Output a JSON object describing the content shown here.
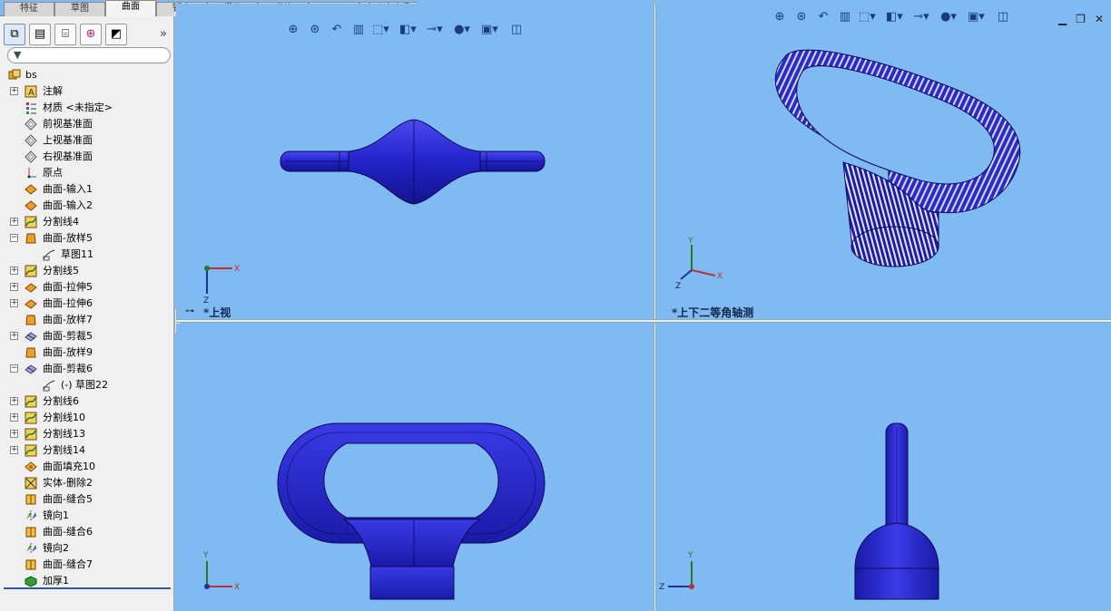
{
  "tabs": [
    "特征",
    "草图",
    "曲面",
    "钣金",
    "焊件",
    "评估",
    "DimXpert",
    "办公室产品"
  ],
  "active_tab": "曲面",
  "panel": {
    "toolbar_icons": [
      "feature-manager-icon",
      "property-manager-icon",
      "configuration-manager-icon",
      "dimxpert-manager-icon",
      "display-manager-icon"
    ],
    "more": "»",
    "filter_icon": "filter-icon",
    "root": "bs",
    "items": [
      {
        "label": "注解",
        "icon": "annotation-icon",
        "expand": "+",
        "level": 1
      },
      {
        "label": "材质 <未指定>",
        "icon": "material-icon",
        "expand": "",
        "level": 1
      },
      {
        "label": "前视基准面",
        "icon": "plane-icon",
        "expand": "",
        "level": 1
      },
      {
        "label": "上视基准面",
        "icon": "plane-icon",
        "expand": "",
        "level": 1
      },
      {
        "label": "右视基准面",
        "icon": "plane-icon",
        "expand": "",
        "level": 1
      },
      {
        "label": "原点",
        "icon": "origin-icon",
        "expand": "",
        "level": 1
      },
      {
        "label": "曲面-输入1",
        "icon": "surface-import-icon",
        "expand": "",
        "level": 1
      },
      {
        "label": "曲面-输入2",
        "icon": "surface-import-icon",
        "expand": "",
        "level": 1
      },
      {
        "label": "分割线4",
        "icon": "split-line-icon",
        "expand": "+",
        "level": 1
      },
      {
        "label": "曲面-放样5",
        "icon": "surface-loft-icon",
        "expand": "−",
        "level": 1
      },
      {
        "label": "草图11",
        "icon": "sketch-icon",
        "expand": "",
        "level": 2
      },
      {
        "label": "分割线5",
        "icon": "split-line-icon",
        "expand": "+",
        "level": 1
      },
      {
        "label": "曲面-拉伸5",
        "icon": "surface-extrude-icon",
        "expand": "+",
        "level": 1
      },
      {
        "label": "曲面-拉伸6",
        "icon": "surface-extrude-icon",
        "expand": "+",
        "level": 1
      },
      {
        "label": "曲面-放样7",
        "icon": "surface-loft-icon",
        "expand": "",
        "level": 1
      },
      {
        "label": "曲面-剪裁5",
        "icon": "surface-trim-icon",
        "expand": "+",
        "level": 1
      },
      {
        "label": "曲面-放样9",
        "icon": "surface-loft-icon",
        "expand": "",
        "level": 1
      },
      {
        "label": "曲面-剪裁6",
        "icon": "surface-trim-icon",
        "expand": "−",
        "level": 1
      },
      {
        "label": "(-) 草图22",
        "icon": "sketch-icon",
        "expand": "",
        "level": 2
      },
      {
        "label": "分割线6",
        "icon": "split-line-icon",
        "expand": "+",
        "level": 1
      },
      {
        "label": "分割线10",
        "icon": "split-line-icon",
        "expand": "+",
        "level": 1
      },
      {
        "label": "分割线13",
        "icon": "split-line-icon",
        "expand": "+",
        "level": 1
      },
      {
        "label": "分割线14",
        "icon": "split-line-icon",
        "expand": "+",
        "level": 1
      },
      {
        "label": "曲面填充10",
        "icon": "surface-fill-icon",
        "expand": "",
        "level": 1
      },
      {
        "label": "实体-删除2",
        "icon": "body-delete-icon",
        "expand": "",
        "level": 1
      },
      {
        "label": "曲面-缝合5",
        "icon": "surface-knit-icon",
        "expand": "",
        "level": 1
      },
      {
        "label": "镜向1",
        "icon": "mirror-icon",
        "expand": "",
        "level": 1
      },
      {
        "label": "曲面-缝合6",
        "icon": "surface-knit-icon",
        "expand": "",
        "level": 1
      },
      {
        "label": "镜向2",
        "icon": "mirror-icon",
        "expand": "",
        "level": 1
      },
      {
        "label": "曲面-缝合7",
        "icon": "surface-knit-icon",
        "expand": "",
        "level": 1
      },
      {
        "label": "加厚1",
        "icon": "thicken-icon",
        "expand": "",
        "level": 1
      }
    ]
  },
  "views": {
    "top_left_label": "*上视",
    "top_right_label": "*上下二等角轴测",
    "toolbar_icons": [
      "zoom-to-fit-icon",
      "zoom-area-icon",
      "previous-view-icon",
      "section-view-icon",
      "view-orientation-icon",
      "display-style-icon",
      "hide-show-icon",
      "appearance-icon",
      "scene-icon",
      "view-settings-icon"
    ],
    "axis_x": "X",
    "axis_y": "Y",
    "axis_z": "Z",
    "window_controls": [
      "minimize-icon",
      "restore-icon",
      "close-icon"
    ]
  },
  "colors": {
    "background": "#7fbaf3",
    "model": "#2a2ad0",
    "model_dark": "#0f0f80"
  }
}
